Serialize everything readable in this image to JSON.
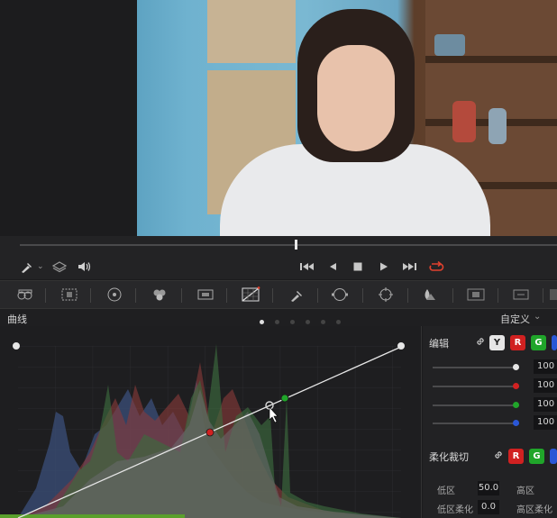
{
  "toolbar": {
    "icons": [
      "picker-icon",
      "layers-icon",
      "speaker-icon"
    ],
    "transport": [
      "skip-back-icon",
      "step-back-icon",
      "stop-icon",
      "play-icon",
      "skip-forward-icon",
      "loop-icon"
    ]
  },
  "tools": [
    "camera-raw-icon",
    "color-match-icon",
    "color-wheels-icon",
    "rgb-mixer-icon",
    "motion-effects-icon",
    "curves-icon",
    "qualifier-icon",
    "window-icon",
    "tracker-icon",
    "blur-icon",
    "key-icon",
    "sizing-icon",
    "3d-icon"
  ],
  "panel": {
    "title": "曲线",
    "preset": "自定义"
  },
  "edit": {
    "title": "编辑",
    "channels": [
      "Y",
      "R",
      "G"
    ],
    "sliders": [
      {
        "color": "#e6e6e6",
        "value": "100"
      },
      {
        "color": "#d12121",
        "value": "100"
      },
      {
        "color": "#20a52a",
        "value": "100"
      },
      {
        "color": "#2a57d6",
        "value": "100"
      }
    ],
    "soft_clip_title": "柔化裁切",
    "soft_clip_channels": [
      "R",
      "G"
    ],
    "low_label": "低区",
    "low_value": "50.0",
    "high_label": "高区",
    "low_soft_label": "低区柔化",
    "low_soft_value": "0.0",
    "high_soft_label": "高区柔化"
  },
  "colors": {
    "accent_red": "#e0412e",
    "curve": "#e6e6e6",
    "point_red": "#d12121",
    "point_green": "#20a52a"
  }
}
